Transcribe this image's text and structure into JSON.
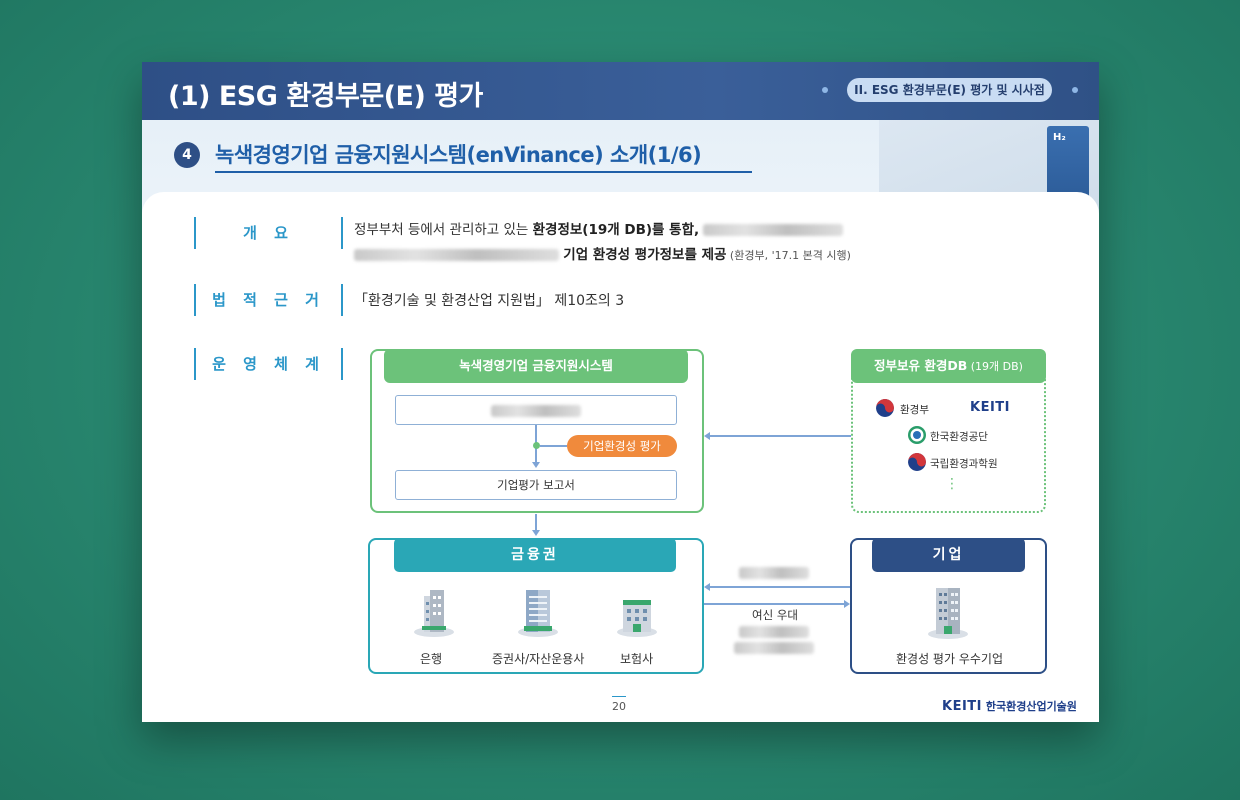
{
  "header": {
    "title": "(1) ESG 환경부문(E) 평가",
    "section_tag": "II. ESG 환경부문(E) 평가 및 시사점"
  },
  "subheader": {
    "number": "4",
    "title": "녹색경영기업 금융지원시스템(enVinance) 소개(1/6)"
  },
  "rows": {
    "overview_label": "개 요",
    "law_label": "법 적 근 거",
    "system_label": "운 영 체 계"
  },
  "overview": {
    "line1_a": "정부부처 등에서 관리하고 있는 ",
    "line1_b": "환경정보(19개 DB)를 통합,",
    "line2_b": "기업 환경성 평가정보를 제공",
    "line2_note": " (환경부, '17.1 본격 시행)"
  },
  "law": {
    "text": "「환경기술 및 환경산업 지원법」 제10조의 3"
  },
  "diagram": {
    "system_title": "녹색경영기업 금융지원시스템",
    "eval_pill": "기업환경성 평가",
    "report_box": "기업평가 보고서",
    "gov_title": "정부보유 환경DB",
    "gov_title_note": " (19개 DB)",
    "orgs": [
      "환경부",
      "KEITI",
      "한국환경공단",
      "국립환경과학원"
    ],
    "ellipsis": "⋮",
    "finance_title": "금융권",
    "finance_items": [
      "은행",
      "증권사/자산운용사",
      "보험사"
    ],
    "company_title": "기업",
    "company_item": "환경성 평가 우수기업",
    "arrow_label": "여신 우대",
    "station_label": "H₂"
  },
  "footer": {
    "page": "20",
    "logo_mark": "KEITI",
    "logo_text": "한국환경산업기술원"
  },
  "colors": {
    "header_bg": "#2e4f86",
    "accent_blue": "#1f5fa8",
    "label_blue": "#2b97c9",
    "green": "#6cc27a",
    "orange": "#f08a3c",
    "teal": "#2aa7b6",
    "navy": "#2d4f86"
  }
}
